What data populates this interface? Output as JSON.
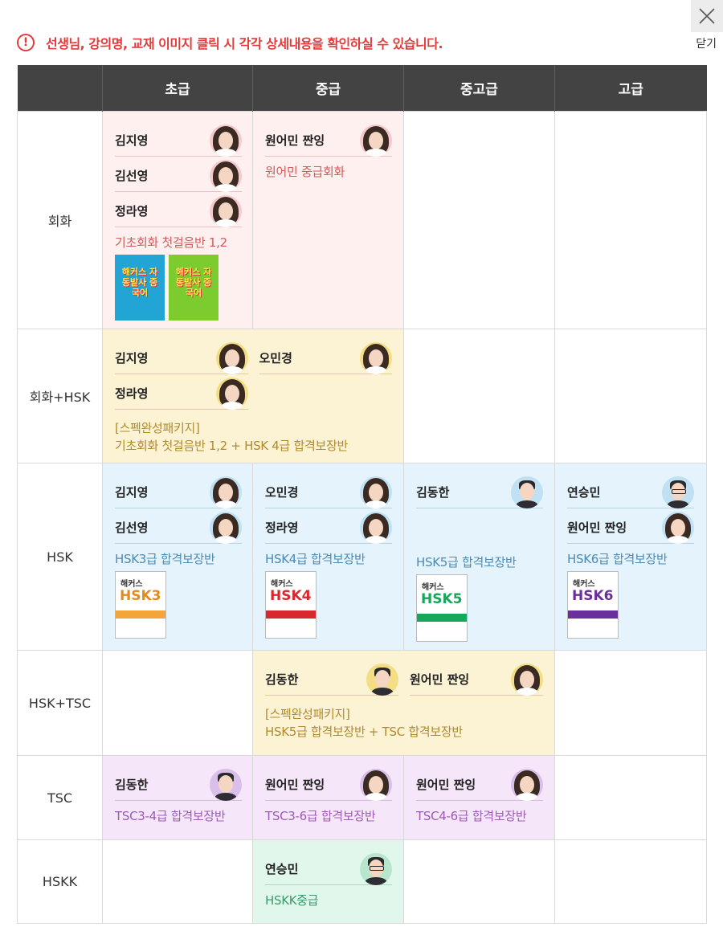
{
  "header": {
    "notice": "선생님, 강의명, 교재 이미지 클릭 시 각각 상세내용을 확인하실 수 있습니다.",
    "close_label": "닫기"
  },
  "columns": [
    "초급",
    "중급",
    "중고급",
    "고급"
  ],
  "rows": {
    "r1": {
      "label": "회화",
      "beginner": {
        "teachers": [
          "김지영",
          "김선영",
          "정라영"
        ],
        "course": "기초회화 첫걸음반 1,2",
        "books": [
          "해커스 자동발사 중국어",
          "해커스 자동발사 중국어"
        ]
      },
      "intermediate": {
        "teachers": [
          "원어민 짠잉"
        ],
        "course": "원어민 중급회화"
      }
    },
    "r2": {
      "label": "회화+HSK",
      "teachers": [
        "김지영",
        "오민경",
        "정라영"
      ],
      "course_line1": "[스펙완성패키지]",
      "course_line2": "기초회화 첫걸음반 1,2 + HSK 4급 합격보장반"
    },
    "r3": {
      "label": "HSK",
      "beginner": {
        "teachers": [
          "김지영",
          "김선영"
        ],
        "course": "HSK3급 합격보장반",
        "book": "HSK3"
      },
      "intermediate": {
        "teachers": [
          "오민경",
          "정라영"
        ],
        "course": "HSK4급 합격보장반",
        "book": "HSK4"
      },
      "upper": {
        "teachers": [
          "김동한"
        ],
        "course": "HSK5급 합격보장반",
        "book": "HSK5"
      },
      "advanced": {
        "teachers": [
          "연승민",
          "원어민 짠잉"
        ],
        "course": "HSK6급 합격보장반",
        "book": "HSK6"
      },
      "book_brand": "해커스"
    },
    "r4": {
      "label": "HSK+TSC",
      "teachers": [
        "김동한",
        "원어민 짠잉"
      ],
      "course_line1": "[스펙완성패키지]",
      "course_line2": "HSK5급 합격보장반 + TSC  합격보장반"
    },
    "r5": {
      "label": "TSC",
      "beginner": {
        "teachers": [
          "김동한"
        ],
        "course": "TSC3-4급 합격보장반"
      },
      "intermediate": {
        "teachers": [
          "원어민 짠잉"
        ],
        "course": "TSC3-6급 합격보장반"
      },
      "upper": {
        "teachers": [
          "원어민 짠잉"
        ],
        "course": "TSC4-6급 합격보장반"
      }
    },
    "r6": {
      "label": "HSKK",
      "intermediate": {
        "teachers": [
          "연승민"
        ],
        "course": "HSKK중급"
      }
    }
  },
  "colors": {
    "header_bg": "#434343",
    "notice_red": "#e23b3b",
    "pink": "#fff0f0",
    "yellow": "#fcf3d4",
    "blue": "#e4f3fc",
    "purple": "#f5e6fa",
    "green": "#e1f7ec"
  }
}
